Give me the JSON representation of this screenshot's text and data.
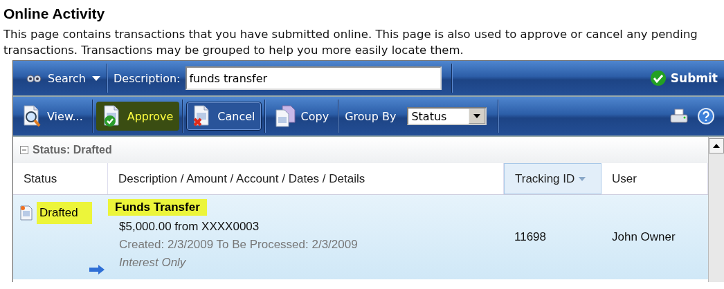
{
  "page": {
    "title": "Online Activity",
    "description": "This page contains transactions that you have submitted online. This page is also used to approve or cancel any pending transactions. Transactions may be grouped to help you more easily locate them."
  },
  "search_bar": {
    "search_label": "Search",
    "field_label": "Description:",
    "value": "funds transfer",
    "submit_label": "Submit"
  },
  "toolbar": {
    "buttons": [
      {
        "kind": "view",
        "label": "View...",
        "highlighted": false,
        "pressed": false
      },
      {
        "kind": "approve",
        "label": "Approve",
        "highlighted": true,
        "pressed": false
      },
      {
        "kind": "cancel",
        "label": "Cancel",
        "highlighted": false,
        "pressed": true
      },
      {
        "kind": "copy",
        "label": "Copy",
        "highlighted": false,
        "pressed": false
      }
    ],
    "group_by_label": "Group By",
    "group_by_value": "Status"
  },
  "group": {
    "label": "Status: Drafted",
    "expanded": true
  },
  "table": {
    "columns": [
      {
        "label": "Status",
        "sorted": false
      },
      {
        "label": "Description / Amount / Account / Dates / Details",
        "sorted": false
      },
      {
        "label": "Tracking ID",
        "sorted": true
      },
      {
        "label": "User",
        "sorted": false
      }
    ],
    "rows": [
      {
        "selected": true,
        "status": "Drafted",
        "status_highlighted": true,
        "title": "Funds Transfer",
        "title_highlighted": true,
        "amount": "$5,000.00 from XXXX0003",
        "dates": "Created: 2/3/2009 To Be Processed: 2/3/2009",
        "details": "Interest Only",
        "tracking_id": "11698",
        "user": "John Owner"
      }
    ]
  }
}
